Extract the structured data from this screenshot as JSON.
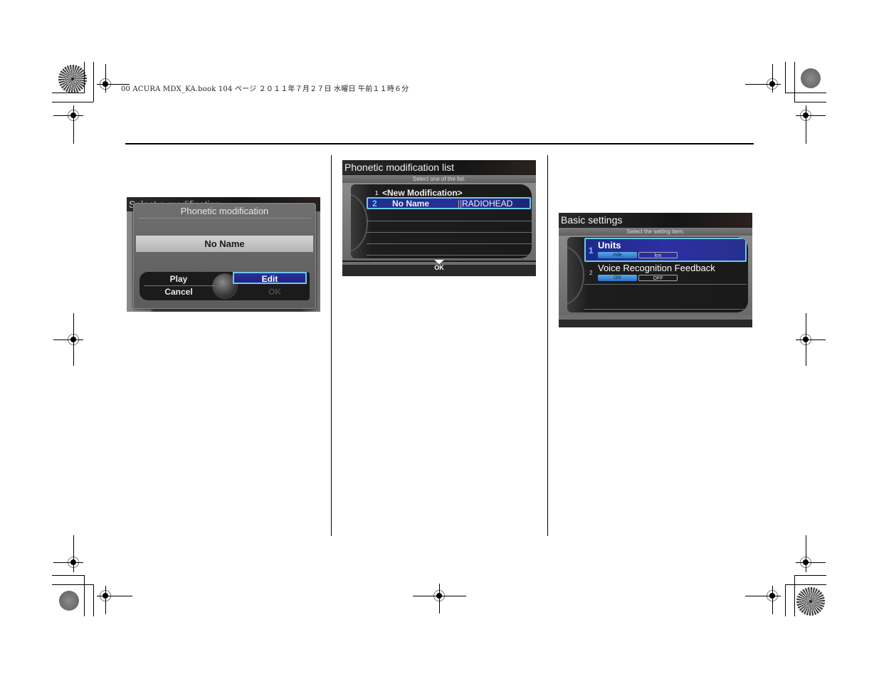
{
  "print_header": {
    "text": "00 ACURA MDX_KA.book  104 ページ  ２０１１年７月２７日  水曜日  午前１１時６分"
  },
  "screens": {
    "phonetic_modification": {
      "background_title": "Select a modification",
      "title": "Phonetic modification",
      "name_field": "No Name",
      "buttons": {
        "play": "Play",
        "cancel": "Cancel",
        "edit": "Edit",
        "ok": "OK"
      },
      "selected_button": "Edit",
      "accent_color": "#2b2f9a",
      "disabled_color": "#4a4a4a"
    },
    "phonetic_modification_list": {
      "title": "Phonetic modification list",
      "subtitle": "Select one of the list.",
      "rows": [
        {
          "num": "1",
          "label": "<New Modification>",
          "value": ""
        },
        {
          "num": "2",
          "label": "No Name",
          "value": "RADIOHEAD",
          "selected": true
        }
      ],
      "ok_label": "OK",
      "highlight_color": "#6fc8ec"
    },
    "basic_settings": {
      "title": "Basic settings",
      "subtitle": "Select the setting item.",
      "items": [
        {
          "num": "1",
          "label": "Units",
          "options": [
            "mile",
            "km"
          ],
          "active_option": "mile",
          "selected": true
        },
        {
          "num": "2",
          "label": "Voice Recognition Feedback",
          "options": [
            "ON",
            "OFF"
          ],
          "active_option": "ON",
          "selected": false
        }
      ]
    }
  }
}
